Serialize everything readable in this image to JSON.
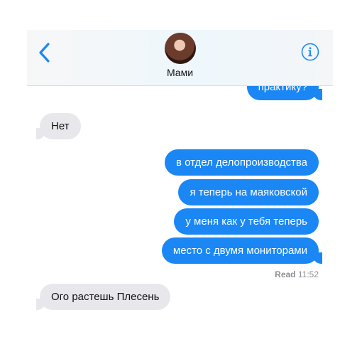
{
  "header": {
    "back_icon": "chevron-left-icon",
    "contact_name": "Мами",
    "info_icon": "info-circle-icon",
    "accent": "#1a87f5"
  },
  "messages": [
    {
      "direction": "sent",
      "text": "практику?"
    },
    {
      "direction": "received",
      "text": "Нет"
    },
    {
      "direction": "sent",
      "text": "в отдел делопроизводства"
    },
    {
      "direction": "sent",
      "text": "я теперь на маяковской"
    },
    {
      "direction": "sent",
      "text": "у меня как у тебя теперь"
    },
    {
      "direction": "sent",
      "text": "место с двумя мониторами"
    },
    {
      "direction": "received",
      "text": "Ого растешь Плесень"
    }
  ],
  "read_receipt": {
    "label": "Read",
    "time": "11:52"
  },
  "colors": {
    "sent_bubble": "#1a87f5",
    "received_bubble": "#e8e8ec",
    "muted_text": "#8e8e93"
  }
}
